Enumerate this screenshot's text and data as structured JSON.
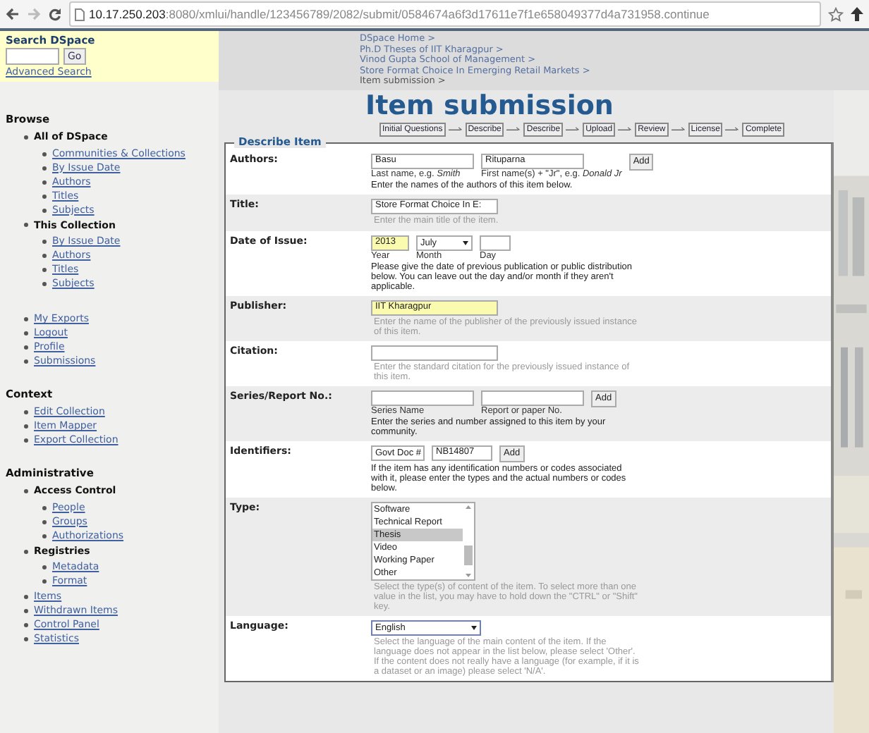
{
  "browser": {
    "address_host": "10.17.250.203",
    "address_rest": ":8080/xmlui/handle/123456789/2082/submit/0584674a6f3d17611e7f1e658049377d4a731958.continue"
  },
  "sidebar": {
    "search": {
      "title": "Search DSpace",
      "button": "Go",
      "link": "Advanced Search"
    },
    "sections": [
      {
        "heading": "Browse",
        "items": [
          {
            "kind": "group",
            "label": "All of DSpace",
            "children": [
              {
                "kind": "link",
                "label": "Communities & Collections"
              },
              {
                "kind": "link",
                "label": "By Issue Date"
              },
              {
                "kind": "link",
                "label": "Authors"
              },
              {
                "kind": "link",
                "label": "Titles"
              },
              {
                "kind": "link",
                "label": "Subjects"
              }
            ]
          },
          {
            "kind": "group",
            "label": "This Collection",
            "children": [
              {
                "kind": "link",
                "label": "By Issue Date"
              },
              {
                "kind": "link",
                "label": "Authors"
              },
              {
                "kind": "link",
                "label": "Titles"
              },
              {
                "kind": "link",
                "label": "Subjects"
              }
            ]
          }
        ]
      },
      {
        "items": [
          {
            "kind": "link",
            "label": "My Exports"
          },
          {
            "kind": "link",
            "label": "Logout"
          },
          {
            "kind": "link",
            "label": "Profile"
          },
          {
            "kind": "link",
            "label": "Submissions"
          }
        ]
      },
      {
        "heading": "Context",
        "items": [
          {
            "kind": "link",
            "label": "Edit Collection"
          },
          {
            "kind": "link",
            "label": "Item Mapper"
          },
          {
            "kind": "link",
            "label": "Export Collection"
          }
        ]
      },
      {
        "heading": "Administrative",
        "items": [
          {
            "kind": "group",
            "label": "Access Control",
            "children": [
              {
                "kind": "link",
                "label": "People"
              },
              {
                "kind": "link",
                "label": "Groups"
              },
              {
                "kind": "link",
                "label": "Authorizations"
              }
            ]
          },
          {
            "kind": "group",
            "label": "Registries",
            "children": [
              {
                "kind": "link",
                "label": "Metadata"
              },
              {
                "kind": "link",
                "label": "Format"
              }
            ]
          },
          {
            "kind": "link",
            "label": "Items"
          },
          {
            "kind": "link",
            "label": "Withdrawn Items"
          },
          {
            "kind": "link",
            "label": "Control Panel"
          },
          {
            "kind": "link",
            "label": "Statistics"
          }
        ]
      }
    ]
  },
  "breadcrumbs": [
    "DSpace Home >",
    "Ph.D Theses of IIT Kharagpur >",
    "Vinod Gupta School of Management >",
    "Store Format Choice In Emerging Retail Markets >",
    "Item submission >"
  ],
  "title": "Item submission",
  "steps": [
    "Initial Questions",
    "Describe",
    "Describe",
    "Upload",
    "Review",
    "License",
    "Complete"
  ],
  "form": {
    "legend": "Describe Item",
    "rows": [
      {
        "kind": "authors",
        "label": "Authors:",
        "controls": [
          {
            "kind": "input",
            "value": "Basu",
            "caption": "Last name, e.g. *Smith*",
            "autofilled": false
          },
          {
            "kind": "input",
            "value": "Rituparna",
            "caption": "First name(s) + \"Jr\", e.g. *Donald Jr*",
            "autofilled": false
          },
          {
            "kind": "button",
            "value": "Add"
          }
        ],
        "help": "Enter the names of the authors of this item below.",
        "muted": false
      },
      {
        "kind": "text",
        "label": "Title:",
        "controls": [
          {
            "kind": "input",
            "value": "Store Format Choice In E:",
            "autofilled": false
          }
        ],
        "help": "Enter the main title of the item.",
        "muted": true
      },
      {
        "kind": "date",
        "label": "Date of Issue:",
        "controls": [
          {
            "kind": "input",
            "value": "2013",
            "caption": "Year",
            "autofilled": true
          },
          {
            "kind": "select",
            "value": "July",
            "caption": "Month"
          },
          {
            "kind": "input",
            "caption": "Day",
            "autofilled": false
          }
        ],
        "help": "Please give the date of previous publication or public distribution below. You can leave out the day and/or month if they aren't applicable.",
        "muted": false
      },
      {
        "kind": "text",
        "label": "Publisher:",
        "controls": [
          {
            "kind": "input",
            "value": "IIT Kharagpur",
            "autofilled": true
          }
        ],
        "help": "Enter the name of the publisher of the previously issued instance of this item.",
        "muted": true
      },
      {
        "kind": "text",
        "label": "Citation:",
        "controls": [
          {
            "kind": "input",
            "autofilled": false
          }
        ],
        "help": "Enter the standard citation for the previously issued instance of this item.",
        "muted": true
      },
      {
        "kind": "series",
        "label": "Series/Report No.:",
        "controls": [
          {
            "kind": "input",
            "caption": "Series Name",
            "autofilled": false
          },
          {
            "kind": "input",
            "caption": "Report or paper No.",
            "autofilled": false
          },
          {
            "kind": "button",
            "value": "Add"
          }
        ],
        "help": "Enter the series and number assigned to this item by your community.",
        "muted": false
      },
      {
        "kind": "identifiers",
        "label": "Identifiers:",
        "controls": [
          {
            "kind": "select",
            "value": "Govt Doc #"
          },
          {
            "kind": "input",
            "value": "NB14807",
            "autofilled": false
          },
          {
            "kind": "button",
            "value": "Add"
          }
        ],
        "help": "If the item has any identification numbers or codes associated with it, please enter the types and the actual numbers or codes below.",
        "muted": false
      },
      {
        "kind": "type",
        "label": "Type:",
        "controls": [
          {
            "kind": "listbox",
            "options": [
              {
                "label": "Software",
                "selected": false
              },
              {
                "label": "Technical Report",
                "selected": false
              },
              {
                "label": "Thesis",
                "selected": true
              },
              {
                "label": "Video",
                "selected": false
              },
              {
                "label": "Working Paper",
                "selected": false
              },
              {
                "label": "Other",
                "selected": false
              }
            ]
          }
        ],
        "help": "Select the type(s) of content of the item. To select more than one value in the list, you may have to hold down the \"CTRL\" or \"Shift\" key.",
        "muted": true
      },
      {
        "kind": "language",
        "label": "Language:",
        "controls": [
          {
            "kind": "select",
            "value": "English"
          }
        ],
        "help": "Select the language of the main content of the item. If the language does not appear in the list below, please select 'Other'. If the content does not really have a language (for example, if it is a dataset or an image) please select 'N/A'.",
        "muted": true
      }
    ]
  }
}
